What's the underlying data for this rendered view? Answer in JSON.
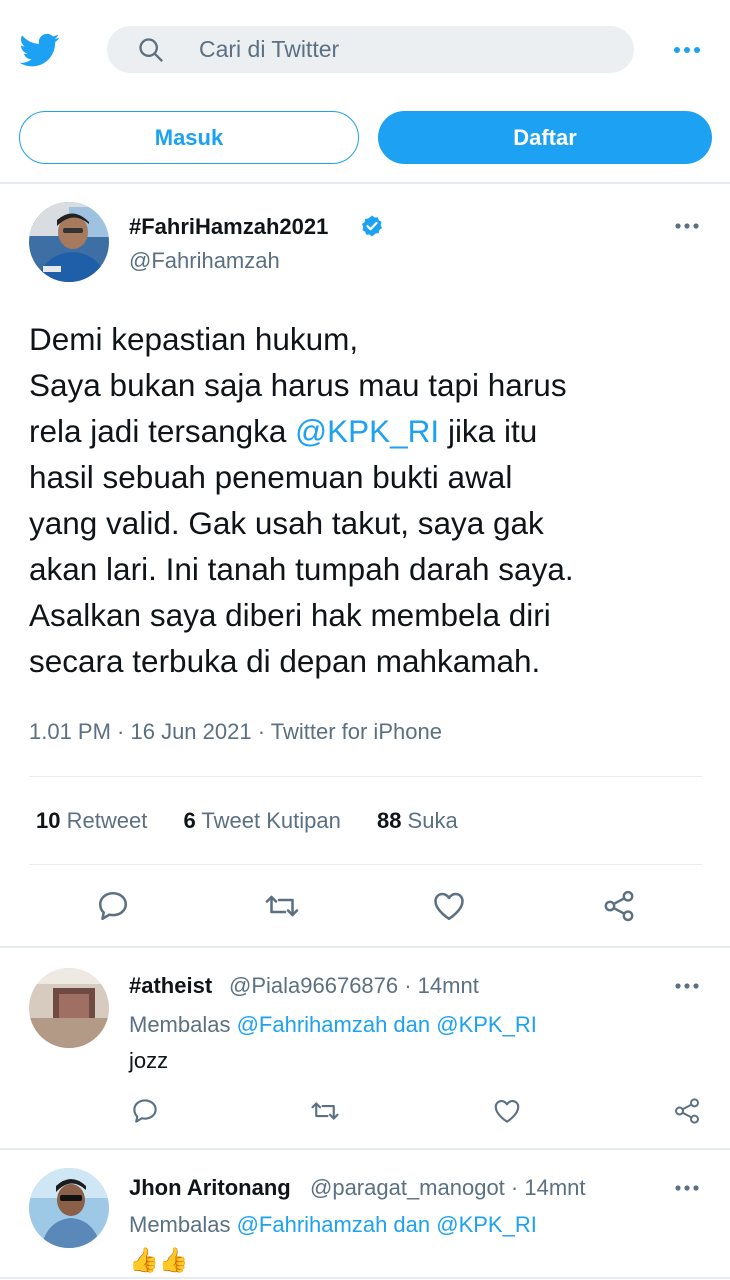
{
  "search": {
    "placeholder": "Cari di Twitter"
  },
  "auth": {
    "login_label": "Masuk",
    "signup_label": "Daftar"
  },
  "tweet": {
    "display_name": "#FahriHamzah2021",
    "handle": "@Fahrihamzah",
    "text_lines": [
      [
        "Demi kepastian hukum,"
      ],
      [
        "Saya bukan saja harus mau tapi harus"
      ],
      [
        "rela jadi tersangka ",
        "@KPK_RI",
        " jika itu"
      ],
      [
        "hasil sebuah penemuan bukti awal"
      ],
      [
        "yang valid. Gak usah takut, saya gak"
      ],
      [
        "akan lari. Ini tanah tumpah darah saya."
      ],
      [
        "Asalkan saya diberi hak membela diri"
      ],
      [
        "secara terbuka di depan mahkamah."
      ]
    ],
    "line1": "Demi kepastian hukum,",
    "line2": "Saya bukan saja harus mau tapi harus",
    "line3_pre": "rela jadi tersangka ",
    "line3_mention": "@KPK_RI",
    "line3_post": " jika itu",
    "line4": "hasil sebuah penemuan bukti awal",
    "line5": "yang valid. Gak usah takut, saya gak",
    "line6": "akan lari. Ini tanah tumpah darah saya.",
    "line7": "Asalkan saya diberi hak membela diri",
    "line8": "secara terbuka di depan mahkamah.",
    "meta": "1.01 PM · 16 Jun 2021 · Twitter for iPhone",
    "stats": {
      "retweet_count": "10",
      "retweet_label": " Retweet",
      "quote_count": "6",
      "quote_label": " Tweet Kutipan",
      "like_count": "88",
      "like_label": " Suka"
    }
  },
  "replies": [
    {
      "display_name": "#atheist",
      "handle_time": "@Piala96676876 · 14mnt",
      "replying_prefix": "Membalas ",
      "replying_to": "@Fahrihamzah dan @KPK_RI",
      "text": "jozz"
    },
    {
      "display_name": "Jhon Aritonang",
      "handle_time": "@paragat_manogot · 14mnt",
      "replying_prefix": "Membalas ",
      "replying_to": "@Fahrihamzah dan @KPK_RI",
      "text": "👍👍"
    }
  ],
  "colors": {
    "accent": "#1da1f2",
    "text": "#0f1419",
    "muted": "#5b7083",
    "divider": "#e6ecf0"
  }
}
